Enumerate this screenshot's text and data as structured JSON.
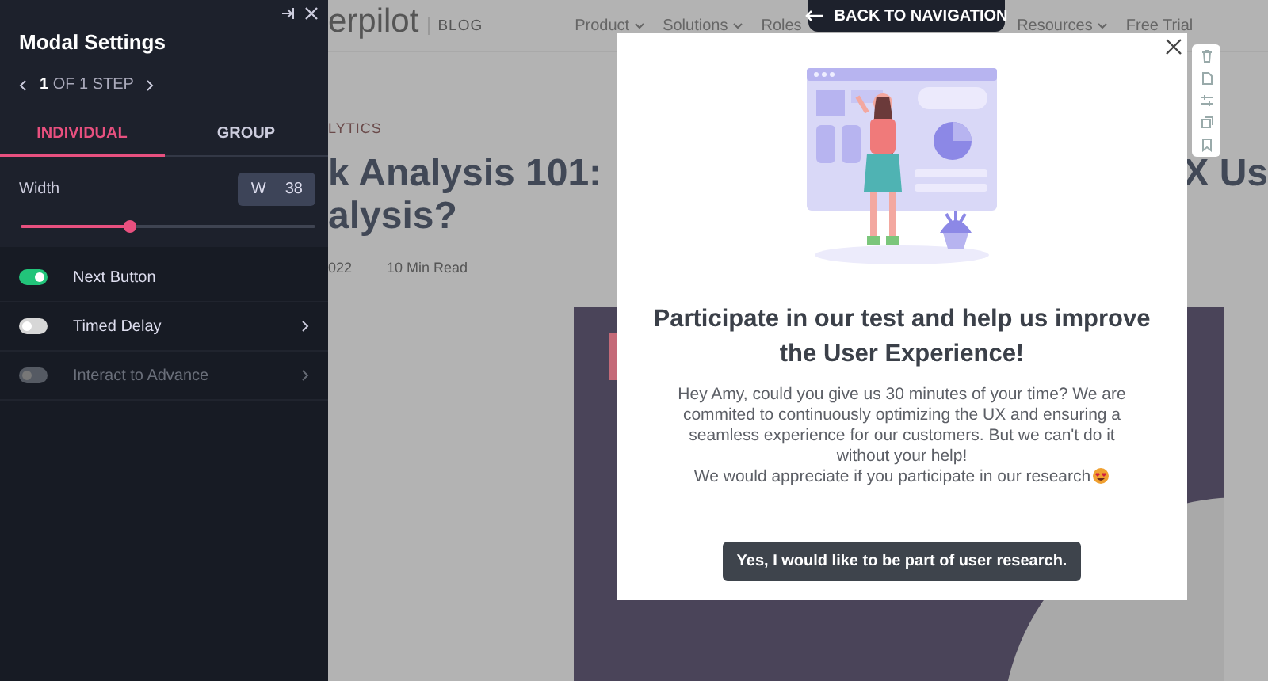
{
  "panel": {
    "title": "Modal Settings",
    "stepper": "**1** OF 1 STEP",
    "tabs": [
      {
        "label": "INDIVIDUAL",
        "selected": true
      },
      {
        "label": "GROUP",
        "selected": false
      }
    ],
    "width": {
      "label": "Width",
      "prefix": "W",
      "value": "38",
      "level": 0.37
    },
    "toggles": [
      {
        "label": "Next Button",
        "on": true,
        "disabled": false,
        "chevron": false
      },
      {
        "label": "Timed Delay",
        "on": false,
        "disabled": false,
        "chevron": true
      },
      {
        "label": "Interact to Advance",
        "on": false,
        "disabled": true,
        "chevron": true
      }
    ]
  },
  "page": {
    "logo": "erpilot",
    "section": "BLOG",
    "nav": [
      {
        "label": "Product",
        "caret": true
      },
      {
        "label": "Solutions",
        "caret": true
      },
      {
        "label": "Roles",
        "caret": false
      },
      {
        "label": "Resources",
        "caret": true
      },
      {
        "label": "Free Trial",
        "caret": false
      }
    ],
    "category": "LYTICS",
    "title_lines": [
      "k Analysis 101:",
      "alysis?"
    ],
    "title_right": "X Us",
    "date": "022",
    "read_time": "10 Min Read"
  },
  "back_button": "BACK TO NAVIGATION",
  "modal": {
    "heading": "Participate in our test and help us improve the User Experience!",
    "body": [
      "Hey Amy, could you give us 30 minutes of your time? We are commited to continuously optimizing the UX and ensuring a seamless experience for our customers. But we can't do it without your help!",
      "We would appreciate if you participate in our research"
    ],
    "button": "Yes, I would like to be part of user research."
  }
}
